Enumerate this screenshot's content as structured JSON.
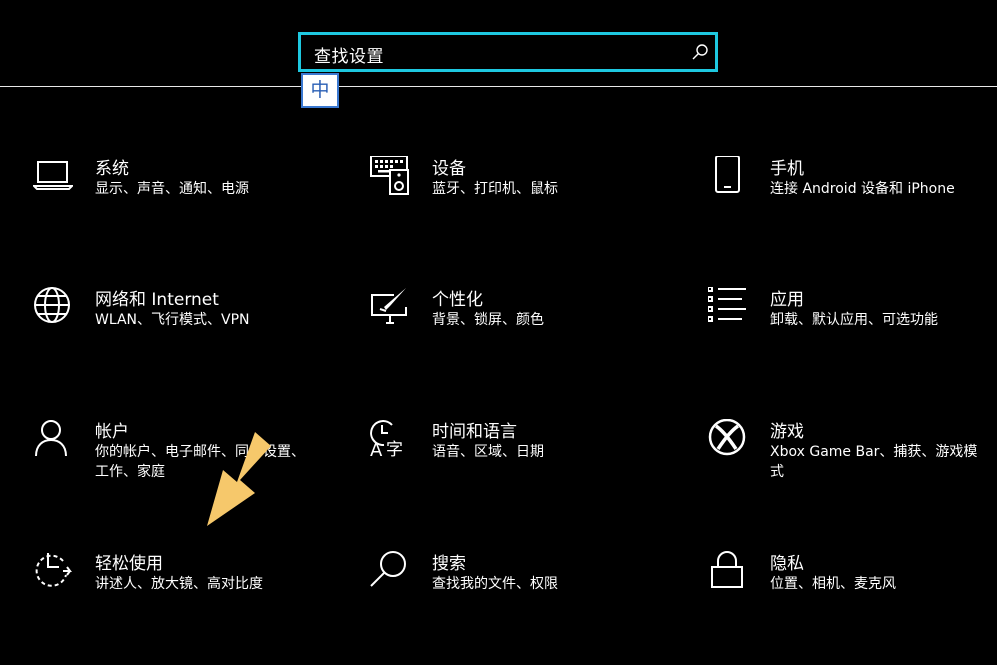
{
  "search": {
    "placeholder": "查找设置",
    "ime_mode": "中"
  },
  "tiles": [
    {
      "icon": "laptop-icon",
      "title": "系统",
      "desc": "显示、声音、通知、电源"
    },
    {
      "icon": "keyboard-speaker-icon",
      "title": "设备",
      "desc": "蓝牙、打印机、鼠标"
    },
    {
      "icon": "phone-icon",
      "title": "手机",
      "desc": "连接 Android 设备和 iPhone"
    },
    {
      "icon": "globe-icon",
      "title": "网络和 Internet",
      "desc": "WLAN、飞行模式、VPN"
    },
    {
      "icon": "paint-monitor-icon",
      "title": "个性化",
      "desc": "背景、锁屏、颜色"
    },
    {
      "icon": "apps-list-icon",
      "title": "应用",
      "desc": "卸载、默认应用、可选功能"
    },
    {
      "icon": "person-icon",
      "title": "帐户",
      "desc": "你的帐户、电子邮件、同步设置、工作、家庭"
    },
    {
      "icon": "time-language-icon",
      "title": "时间和语言",
      "desc": "语音、区域、日期"
    },
    {
      "icon": "xbox-icon",
      "title": "游戏",
      "desc": "Xbox Game Bar、捕获、游戏模式"
    },
    {
      "icon": "ease-of-access-icon",
      "title": "轻松使用",
      "desc": "讲述人、放大镜、高对比度"
    },
    {
      "icon": "search-icon",
      "title": "搜索",
      "desc": "查找我的文件、权限"
    },
    {
      "icon": "lock-icon",
      "title": "隐私",
      "desc": "位置、相机、麦克风"
    }
  ],
  "colors": {
    "background": "#000000",
    "search_border": "#1ec8e0",
    "arrow": "#f6c86b"
  }
}
